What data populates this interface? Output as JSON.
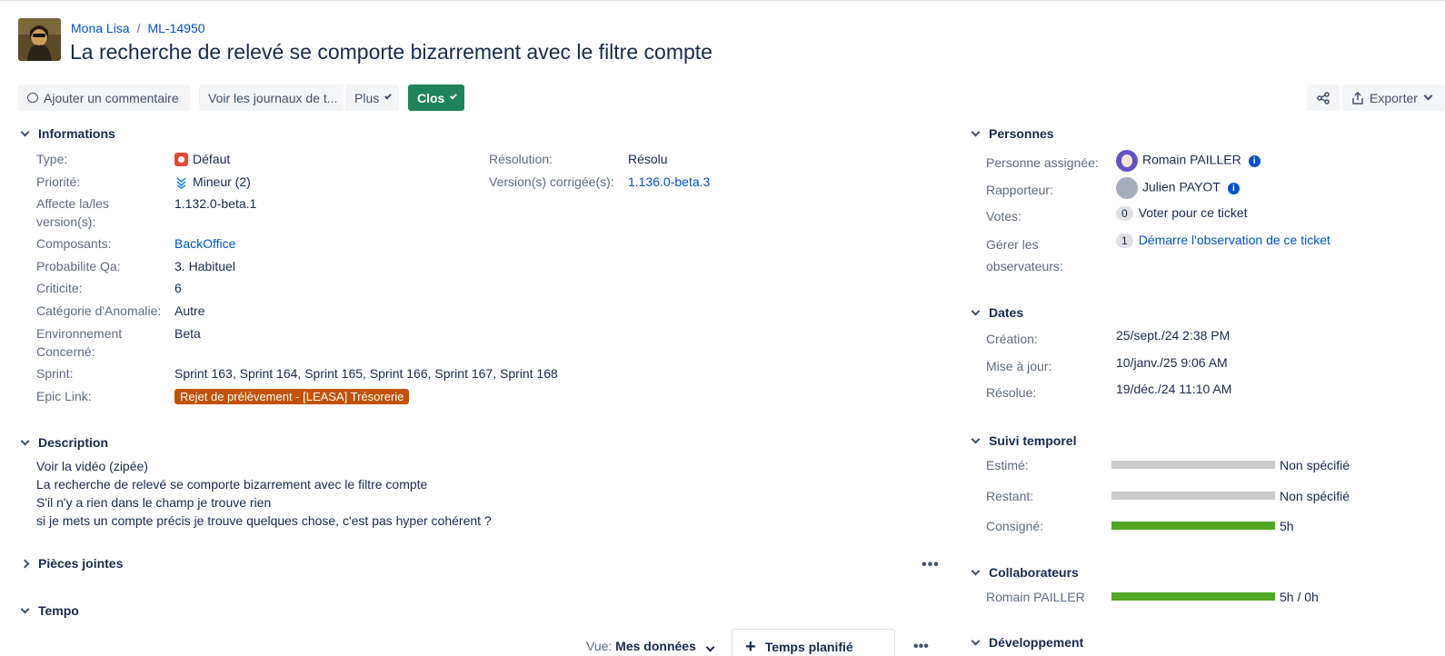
{
  "breadcrumb": {
    "project": "Mona Lisa",
    "issue_key": "ML-14950"
  },
  "issue": {
    "title": "La recherche de relevé se comporte bizarrement avec le filtre compte"
  },
  "toolbar": {
    "comment_label": "Ajouter un commentaire",
    "logs_label": "Voir les journaux de t...",
    "more_label": "Plus",
    "status_label": "Clos",
    "export_label": "Exporter"
  },
  "details": {
    "heading": "Informations",
    "type_label": "Type:",
    "type_value": "Défaut",
    "priority_label": "Priorité:",
    "priority_value": "Mineur (2)",
    "affects_label_1": "Affecte la/les",
    "affects_label_2": "version(s):",
    "affects_value": "1.132.0-beta.1",
    "components_label": "Composants:",
    "components_value": "BackOffice",
    "probability_label": "Probabilite Qa:",
    "probability_value": "3. Habituel",
    "criticity_label": "Criticite:",
    "criticity_value": "6",
    "category_label": "Catégorie d'Anomalie:",
    "category_value": "Autre",
    "env_label_1": "Environnement",
    "env_label_2": "Concerné:",
    "env_value": "Beta",
    "sprint_label": "Sprint:",
    "sprint_value": "Sprint 163, Sprint 164, Sprint 165, Sprint 166, Sprint 167, Sprint 168",
    "epic_label": "Epic Link:",
    "epic_value": "Rejet de prélèvement - [LEASA] Trésorerie",
    "resolution_label": "Résolution:",
    "resolution_value": "Résolu",
    "fixversion_label": "Version(s) corrigée(s):",
    "fixversion_value": "1.136.0-beta.3"
  },
  "description": {
    "heading": "Description",
    "lines": [
      "Voir la vidéo (zipée)",
      "La recherche de relevé se comporte bizarrement avec le filtre compte",
      "S'il n'y a rien dans le champ je trouve rien",
      "si je mets un compte précis je trouve quelques chose, c'est pas hyper cohérent ?"
    ]
  },
  "attachments": {
    "heading": "Pièces jointes"
  },
  "tempo": {
    "heading": "Tempo",
    "view_label": "Vue:",
    "view_value": "Mes données",
    "planned_label": "Temps planifié"
  },
  "people": {
    "heading": "Personnes",
    "assignee_label": "Personne assignée:",
    "assignee_value": "Romain PAILLER",
    "reporter_label": "Rapporteur:",
    "reporter_value": "Julien PAYOT",
    "votes_label": "Votes:",
    "votes_count": "0",
    "votes_action": "Voter pour ce ticket",
    "watchers_label_1": "Gérer les",
    "watchers_label_2": "observateurs:",
    "watchers_count": "1",
    "watchers_action": "Démarre l'observation de ce ticket"
  },
  "dates": {
    "heading": "Dates",
    "created_label": "Création:",
    "created_value": "25/sept./24 2:38 PM",
    "updated_label": "Mise à jour:",
    "updated_value": "10/janv./25 9:06 AM",
    "resolved_label": "Résolue:",
    "resolved_value": "19/déc./24 11:10 AM"
  },
  "time_tracking": {
    "heading": "Suivi temporel",
    "estimated_label": "Estimé:",
    "estimated_value": "Non spécifié",
    "estimated_fill": 0,
    "remaining_label": "Restant:",
    "remaining_value": "Non spécifié",
    "remaining_fill": 0,
    "logged_label": "Consigné:",
    "logged_value": "5h",
    "logged_fill": 1
  },
  "collaborators": {
    "heading": "Collaborateurs",
    "name": "Romain PAILLER",
    "value": "5h / 0h",
    "fill": 1
  },
  "development": {
    "heading": "Développement"
  },
  "colors": {
    "accent": "#0052cc",
    "status_done": "#1f845a",
    "epic": "#c25100",
    "bar_empty": "#cccccc",
    "bar_logged": "#51a825"
  }
}
